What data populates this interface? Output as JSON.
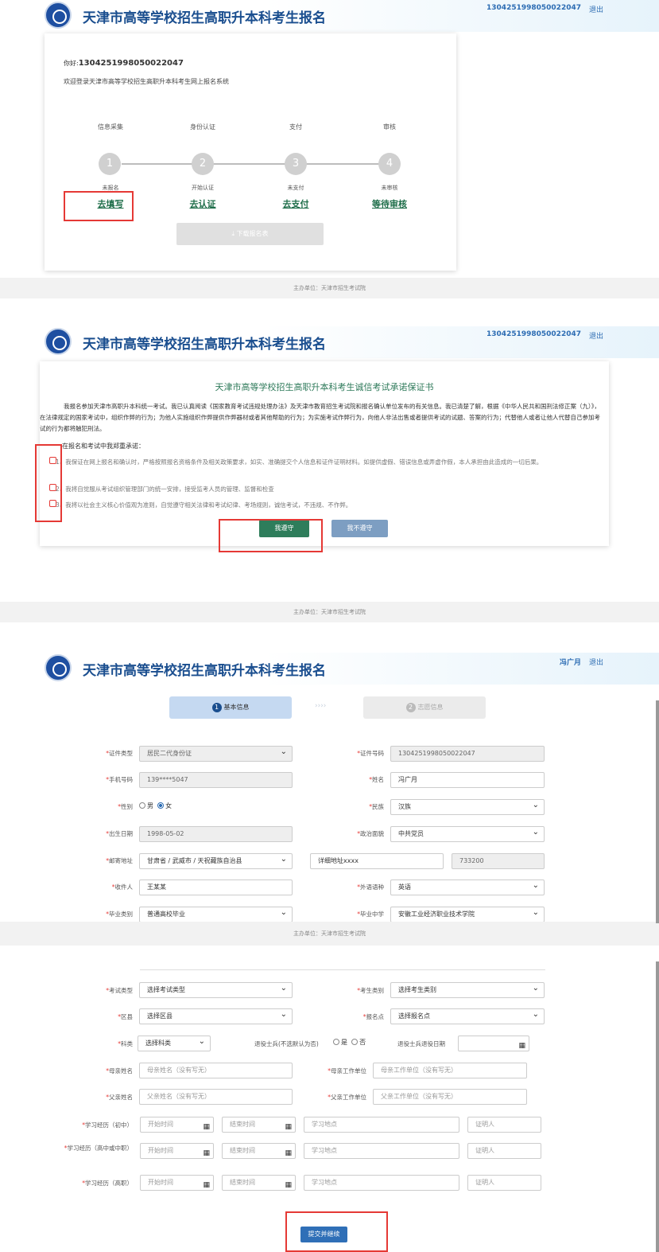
{
  "site_title": "天津市高等学校招生高职升本科考生报名",
  "logout_label": "退出",
  "footer_text": "主办单位：天津市招生考试院",
  "screen1": {
    "user_id": "1304251998050022047",
    "greeting_prefix": "你好:",
    "greeting_id": "1304251998050022047",
    "welcome": "欢迎登录天津市高等学校招生高职升本科考生网上报名系统",
    "steps": [
      {
        "title": "信息采集",
        "num": "1",
        "status": "未报名",
        "link": "去填写"
      },
      {
        "title": "身份认证",
        "num": "2",
        "status": "开始认证",
        "link": "去认证"
      },
      {
        "title": "支付",
        "num": "3",
        "status": "未支付",
        "link": "去支付"
      },
      {
        "title": "审核",
        "num": "4",
        "status": "未审核",
        "link": "等待审核"
      }
    ],
    "download_label": "⤓ 下载报名表"
  },
  "screen2": {
    "user_id": "1304251998050022047",
    "pledge_title": "天津市高等学校招生高职升本科考生诚信考试承诺保证书",
    "intro": "我报名参加天津市高职升本科统一考试。我已认真阅读《国家教育考试违规处理办法》及天津市教育招生考试院和报名确认单位发布的有关信息。我已清楚了解，根据《中华人民共和国刑法修正案（九）》，在法律规定的国家考试中，组织作弊的行为；为他人实施组织作弊提供作弊器材或者其他帮助的行为；为实施考试作弊行为，向他人非法出售或者提供考试的试题、答案的行为；代替他人或者让他人代替自己参加考试的行为都将触犯刑法。",
    "commit_heading": "在报名和考试中我郑重承诺：",
    "items": [
      "1、我保证在网上报名和确认时，严格按照报名资格条件及相关政策要求，如实、准确提交个人信息和证件证明材料。如提供虚假、错误信息或弄虚作假，本人承担由此造成的一切后果。",
      "2、我将自觉服从考试组织管理部门的统一安排，接受监考人员的管理、监督和检查",
      "3、我将以社会主义核心价值观为准则，自觉遵守相关法律和考试纪律、考场规则，诚信考试，不违规、不作弊。"
    ],
    "agree_label": "我遵守",
    "disagree_label": "我不遵守"
  },
  "screen3": {
    "user_name": "冯广月",
    "tab1": {
      "num": "1",
      "label": "基本信息"
    },
    "tab2": {
      "num": "2",
      "label": "志愿信息"
    },
    "labels": {
      "id_type": "证件类型",
      "id_no": "证件号码",
      "phone": "手机号码",
      "name": "姓名",
      "gender": "性别",
      "ethnic": "民族",
      "birth": "出生日期",
      "politics": "政治面貌",
      "address": "邮寄地址",
      "receiver": "收件人",
      "language": "外语语种",
      "grad_type": "毕业类别",
      "grad_school": "毕业中学"
    },
    "values": {
      "id_type": "居民二代身份证",
      "id_no": "1304251998050022047",
      "phone": "139****5047",
      "name": "冯广月",
      "gender_male": "男",
      "gender_female": "女",
      "ethnic": "汉族",
      "birth": "1998-05-02",
      "politics": "中共党员",
      "address": "甘肃省 / 武威市 / 天祝藏族自治县",
      "address_detail": "详细地址xxxx",
      "postcode": "733200",
      "receiver": "王某某",
      "language": "英语",
      "grad_type": "普通高校毕业",
      "grad_school": "安徽工业经济职业技术学院"
    }
  },
  "screen4": {
    "labels": {
      "exam_type": "考试类型",
      "candidate_type": "考生类别",
      "district": "区县",
      "site": "报名点",
      "subject": "科类",
      "veteran": "退役士兵(不选默认为否)",
      "veteran_yes": "是",
      "veteran_no": "否",
      "veteran_date": "退役士兵退役日期",
      "mother_name": "母亲姓名",
      "mother_work": "母亲工作单位",
      "father_name": "父亲姓名",
      "father_work": "父亲工作单位",
      "edu_junior": "学习经历（初中）",
      "edu_senior": "学习经历（高中或中职）",
      "edu_college": "学习经历（高职）"
    },
    "placeholders": {
      "exam_type": "选择考试类型",
      "candidate_type": "选择考生类别",
      "district": "选择区县",
      "site": "选择报名点",
      "subject": "选择科类",
      "mother_name": "母亲姓名（没有写无）",
      "mother_work": "母亲工作单位（没有写无）",
      "father_name": "父亲姓名（没有写无）",
      "father_work": "父亲工作单位（没有写无）",
      "start": "开始时间",
      "end": "结束时间",
      "place": "学习地点",
      "witness": "证明人"
    },
    "submit_label": "提交并继续"
  },
  "colors": {
    "brand": "#1a4e8f",
    "green": "#2e7d5b",
    "highlight": "#e53935"
  }
}
